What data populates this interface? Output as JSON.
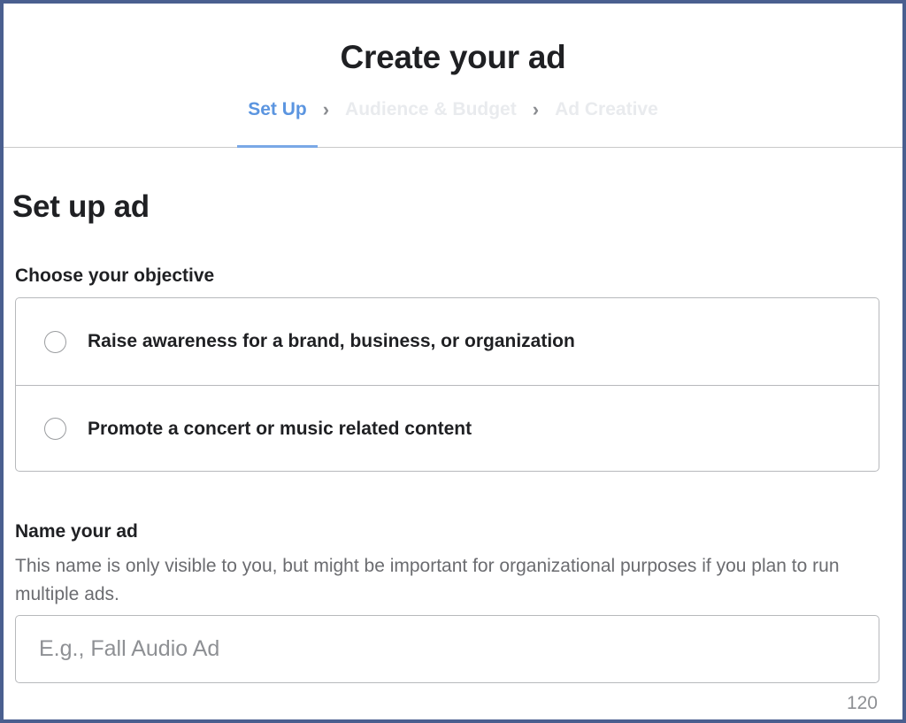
{
  "header": {
    "title": "Create your ad",
    "steps": [
      {
        "label": "Set Up",
        "state": "active"
      },
      {
        "label": "Audience & Budget",
        "state": "inactive"
      },
      {
        "label": "Ad Creative",
        "state": "inactive"
      }
    ],
    "separator_icon": "chevron-right-icon"
  },
  "setup": {
    "title": "Set up ad",
    "objective_label": "Choose your objective",
    "objectives": [
      {
        "label": "Raise awareness for a brand, business, or organization",
        "selected": false
      },
      {
        "label": "Promote a concert or music related content",
        "selected": false
      }
    ],
    "name_label": "Name your ad",
    "name_help": "This name is only visible to you, but might be important for organizational purposes if you plan to run multiple ads.",
    "name_value": "",
    "name_placeholder": "E.g., Fall Audio Ad",
    "char_count": "120"
  },
  "colors": {
    "accent": "#5b95e0",
    "frame_border": "#4a5f8f",
    "inactive_step": "#e9ebee",
    "text": "#1f2023",
    "muted_text": "#6b6c70"
  }
}
